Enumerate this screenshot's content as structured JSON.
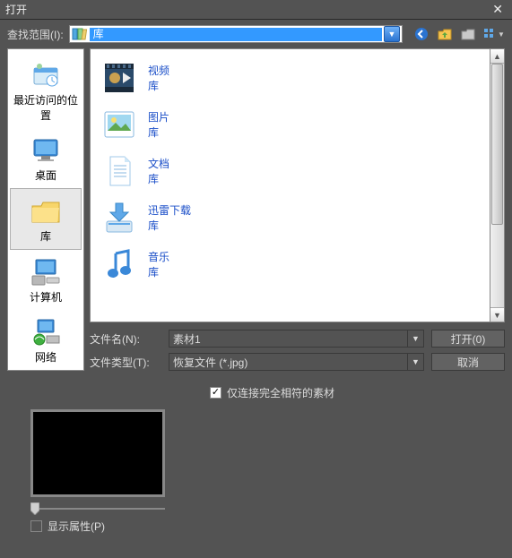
{
  "title": "打开",
  "search": {
    "label": "查找范围(I):",
    "value": "库"
  },
  "places": [
    {
      "id": "recent",
      "label": "最近访问的位置"
    },
    {
      "id": "desktop",
      "label": "桌面"
    },
    {
      "id": "library",
      "label": "库",
      "selected": true
    },
    {
      "id": "computer",
      "label": "计算机"
    },
    {
      "id": "network",
      "label": "网络"
    }
  ],
  "libraries": [
    {
      "name": "视频",
      "type": "库",
      "icon": "video"
    },
    {
      "name": "图片",
      "type": "库",
      "icon": "pictures"
    },
    {
      "name": "文档",
      "type": "库",
      "icon": "documents"
    },
    {
      "name": "迅雷下载",
      "type": "库",
      "icon": "downloads"
    },
    {
      "name": "音乐",
      "type": "库",
      "icon": "music"
    }
  ],
  "form": {
    "filename_label": "文件名(N):",
    "filename_value": "素材1",
    "filetype_label": "文件类型(T):",
    "filetype_value": "恢复文件 (*.jpg)",
    "open_btn": "打开(0)",
    "cancel_btn": "取消"
  },
  "options": {
    "only_connect_label": "仅连接完全相符的素材",
    "only_connect_checked": true,
    "show_props_label": "显示属性(P)",
    "show_props_checked": false
  }
}
